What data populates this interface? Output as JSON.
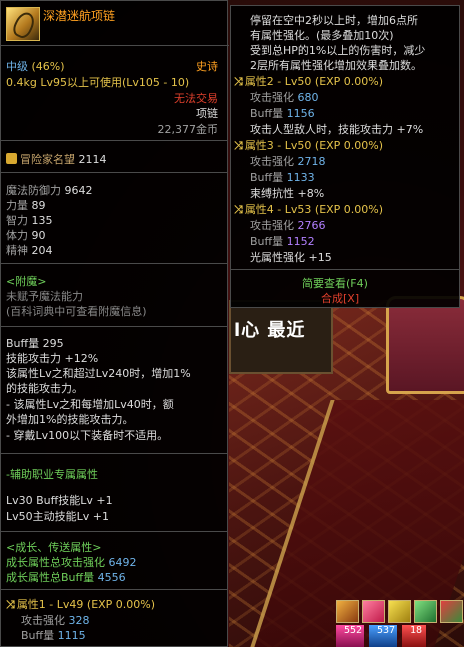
{
  "item": {
    "name": "深潜迷航项链",
    "grade": "中级",
    "grade_pct": "(46%)",
    "rarity": "史诗",
    "weight": "0.4kg",
    "level_req": "Lv95以上可使用(Lv105 - 10)",
    "trade": "无法交易",
    "type": "项链",
    "price": "22,377金币"
  },
  "fame": {
    "label": "冒险家名望",
    "value": "2114"
  },
  "stats": [
    {
      "label": "魔法防御力",
      "value": "9642"
    },
    {
      "label": "力量",
      "value": "89"
    },
    {
      "label": "智力",
      "value": "135"
    },
    {
      "label": "体力",
      "value": "90"
    },
    {
      "label": "精神",
      "value": "204"
    }
  ],
  "enchant": {
    "title": "<附魔>",
    "line1": "未赋予魔法能力",
    "line2": "(百科词典中可查看附魔信息)"
  },
  "buff_block": {
    "buff_label": "Buff量",
    "buff_value": "295",
    "skill_label": "技能攻击力",
    "skill_value": "+12%",
    "desc1": "该属性Lv之和超过Lv240时，增加1%",
    "desc2": "的技能攻击力。",
    "desc3": "- 该属性Lv之和每增加Lv40时，额",
    "desc4": "外增加1%的技能攻击力。",
    "desc5": "- 穿戴Lv100以下装备时不适用。"
  },
  "support": {
    "title": "-辅助职业专属属性",
    "line1": "Lv30 Buff技能Lv +1",
    "line2": "Lv50主动技能Lv +1"
  },
  "growth": {
    "title": "<成长、传送属性>",
    "line1_label": "成长属性总攻击强化",
    "line1_value": "6492",
    "line2_label": "成长属性总Buff量",
    "line2_value": "4556",
    "attr1_title": "属性1 - Lv49 (EXP 0.00%)",
    "attr1_atk_label": "攻击强化",
    "attr1_atk_value": "328",
    "attr1_buff_label": "Buff量",
    "attr1_buff_value": "1115"
  },
  "right": {
    "desc1": "停留在空中2秒以上时，增加6点所",
    "desc2": "有属性强化。(最多叠加10次)",
    "desc3": "受到总HP的1%以上的伤害时，减少",
    "desc4": "2层所有属性强化增加效果叠加数。",
    "attr2_title": "属性2 - Lv50 (EXP 0.00%)",
    "attr2_atk_label": "攻击强化",
    "attr2_atk_value": "680",
    "attr2_buff_label": "Buff量",
    "attr2_buff_value": "1156",
    "attr2_extra": "攻击人型敌人时，技能攻击力 +7%",
    "attr3_title": "属性3 - Lv50 (EXP 0.00%)",
    "attr3_atk_label": "攻击强化",
    "attr3_atk_value": "2718",
    "attr3_buff_label": "Buff量",
    "attr3_buff_value": "1133",
    "attr3_extra": "束缚抗性 +8%",
    "attr4_title": "属性4 - Lv53 (EXP 0.00%)",
    "attr4_atk_label": "攻击强化",
    "attr4_atk_value": "2766",
    "attr4_buff_label": "Buff量",
    "attr4_buff_value": "1152",
    "attr4_extra": "光属性强化 +15",
    "btn_simple": "简要查看(F4)",
    "btn_synth": "合成[X]"
  },
  "scene": {
    "sign_text": "l心 最近",
    "pot1": "552",
    "pot2": "537",
    "pot3": "18"
  }
}
